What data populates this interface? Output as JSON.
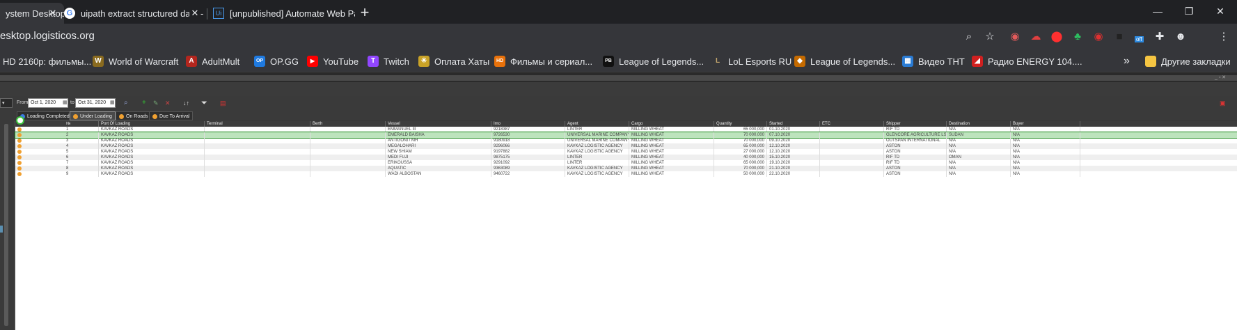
{
  "tabs": [
    {
      "label": "ystem Desktop",
      "active": true
    },
    {
      "label": "uipath extract structured data - I",
      "active": false
    },
    {
      "label": "[unpublished] Automate Web Pa",
      "active": false
    }
  ],
  "new_tab_label": "+",
  "window_controls": {
    "minimize": "—",
    "maximize": "❐",
    "close": "✕"
  },
  "address_bar": {
    "url": "esktop.logisticos.org"
  },
  "extensions": {
    "off_badge": "off"
  },
  "bookmarks": [
    {
      "label": "HD 2160p: фильмы...",
      "color": "#35363a",
      "glyph": ""
    },
    {
      "label": "World of Warcraft",
      "color": "#8a6b1f",
      "glyph": "W"
    },
    {
      "label": "AdultMult",
      "color": "#b3261e",
      "glyph": "A"
    },
    {
      "label": "OP.GG",
      "color": "#1f7ae0",
      "glyph": "OP"
    },
    {
      "label": "YouTube",
      "color": "#ff0000",
      "glyph": "▶"
    },
    {
      "label": "Twitch",
      "color": "#9146ff",
      "glyph": "T"
    },
    {
      "label": "Оплата Хаты",
      "color": "#c9a227",
      "glyph": "☀"
    },
    {
      "label": "Фильмы и сериал...",
      "color": "#e8710a",
      "glyph": "HD"
    },
    {
      "label": "League of Legends...",
      "color": "#111111",
      "glyph": "PB"
    },
    {
      "label": "LoL Esports RU",
      "color": "#35363a",
      "glyph": "L"
    },
    {
      "label": "League of Legends...",
      "color": "#c46a00",
      "glyph": "◆"
    },
    {
      "label": "Видео ТНТ",
      "color": "#2a7bd3",
      "glyph": "▦"
    },
    {
      "label": "Радио ENERGY 104....",
      "color": "#d02020",
      "glyph": "◢"
    }
  ],
  "bookmarks_overflow": "»",
  "other_bookmarks": "Другие закладки",
  "filter": {
    "from_label": "From",
    "from_value": "Oct 1, 2020",
    "to_label": "to",
    "to_value": "Oct 31, 2020"
  },
  "status_tabs": [
    {
      "label": "Loading Completed",
      "color": "#3b7be0",
      "active": false
    },
    {
      "label": "Under Loading",
      "color": "#f0a030",
      "active": true
    },
    {
      "label": "On Roads",
      "color": "#f0a030",
      "active": false
    },
    {
      "label": "Due To Arrival",
      "color": "#f0a030",
      "active": false
    }
  ],
  "grid": {
    "columns": [
      "№",
      "Port Of Loading",
      "Terminal",
      "Berth",
      "Vessel",
      "Imo",
      "Agent",
      "Cargo",
      "Quantity",
      "Started",
      "ETC",
      "Shipper",
      "Destination",
      "Buyer"
    ],
    "rows": [
      [
        "1",
        "KAVKAZ ROADS",
        "",
        "",
        "EMMANUEL III",
        "9218387",
        "LINTER",
        "MILLING WHEAT",
        "65 000,000",
        "01.10.2020",
        "",
        "RIF TD",
        "N/A",
        "N/A"
      ],
      [
        "2",
        "KAVKAZ ROADS",
        "",
        "",
        "EMERALD BAISHA",
        "9726530",
        "UNIVERSAL MARINE COMPANY...",
        "MILLING WHEAT",
        "70 000,000",
        "07.10.2020",
        "",
        "GLENCORE AGRICULTURE LSC",
        "SUDAN",
        "N/A"
      ],
      [
        "3",
        "KAVKAZ ROADS",
        "",
        "",
        "ANTIGONI / MH",
        "9180918",
        "UNIVERSAL MARINE COMPANY...",
        "MILLING WHEAT",
        "70 000,000",
        "09.10.2020",
        "",
        "OUTSPAN INTERNATIONAL",
        "N/A",
        "N/A"
      ],
      [
        "4",
        "KAVKAZ ROADS",
        "",
        "",
        "MEGALOHARI",
        "9296066",
        "KAVKAZ LOGISTIC AGENCY",
        "MILLING WHEAT",
        "65 000,000",
        "12.10.2020",
        "",
        "ASTON",
        "N/A",
        "N/A"
      ],
      [
        "5",
        "KAVKAZ ROADS",
        "",
        "",
        "NEW SHIAM",
        "9197882",
        "KAVKAZ LOGISTIC AGENCY",
        "MILLING WHEAT",
        "27 000,000",
        "12.10.2020",
        "",
        "ASTON",
        "N/A",
        "N/A"
      ],
      [
        "6",
        "KAVKAZ ROADS",
        "",
        "",
        "MEDI FUJI",
        "9875175",
        "LINTER",
        "MILLING WHEAT",
        "40 000,000",
        "15.10.2020",
        "",
        "RIF TD",
        "OMAN",
        "N/A"
      ],
      [
        "7",
        "KAVKAZ ROADS",
        "",
        "",
        "ERIKOUSSA",
        "9291092",
        "LINTER",
        "MILLING WHEAT",
        "65 000,000",
        "19.10.2020",
        "",
        "RIF TD",
        "N/A",
        "N/A"
      ],
      [
        "8",
        "KAVKAZ ROADS",
        "",
        "",
        "AQUATIC",
        "9363089",
        "KAVKAZ LOGISTIC AGENCY",
        "MILLING WHEAT",
        "70 000,000",
        "21.10.2020",
        "",
        "ASTON",
        "N/A",
        "N/A"
      ],
      [
        "9",
        "KAVKAZ ROADS",
        "",
        "",
        "WADI ALBOSTAN",
        "9460722",
        "KAVKAZ LOGISTIC AGENCY",
        "MILLING WHEAT",
        "50 000,000",
        "22.10.2020",
        "",
        "ASTON",
        "N/A",
        "N/A"
      ]
    ],
    "selected_row": 1
  }
}
